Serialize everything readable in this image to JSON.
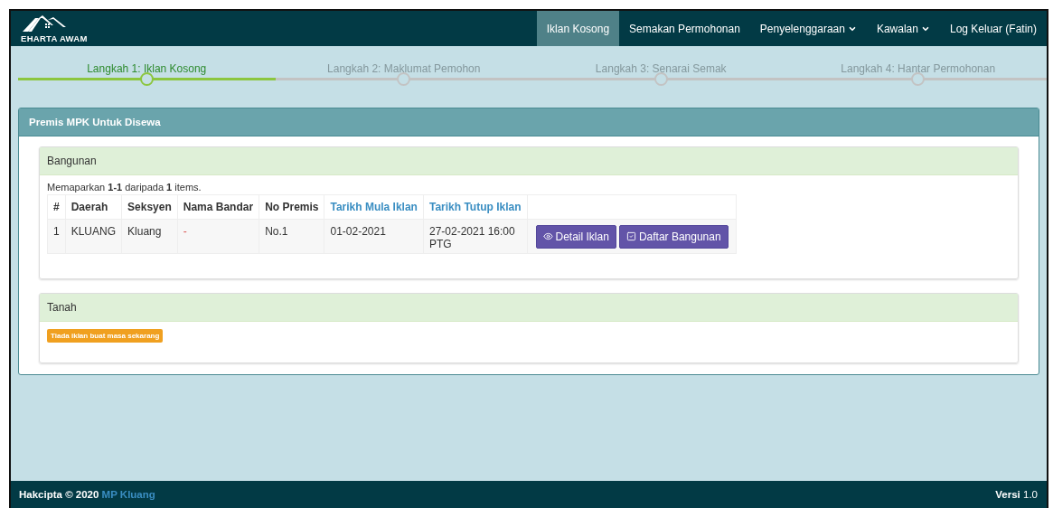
{
  "navbar": {
    "brand": "EHARTA AWAM",
    "items": [
      {
        "label": "Iklan Kosong",
        "selected": true,
        "dropdown": false
      },
      {
        "label": "Semakan Permohonan",
        "selected": false,
        "dropdown": false
      },
      {
        "label": "Penyelenggaraan",
        "selected": false,
        "dropdown": true
      },
      {
        "label": "Kawalan",
        "selected": false,
        "dropdown": true
      },
      {
        "label": "Log Keluar (Fatin)",
        "selected": false,
        "dropdown": false
      }
    ]
  },
  "steps": [
    {
      "label": "Langkah 1: Iklan Kosong",
      "active": true
    },
    {
      "label": "Langkah 2: Maklumat Pemohon",
      "active": false
    },
    {
      "label": "Langkah 3: Senarai Semak",
      "active": false
    },
    {
      "label": "Langkah 4: Hantar Permohonan",
      "active": false
    }
  ],
  "panel": {
    "title": "Premis MPK Untuk Disewa",
    "sections": [
      {
        "kind": "table",
        "title": "Bangunan",
        "summary": "Memaparkan **1-1** daripada **1** items.",
        "columns": [
          {
            "label": "#",
            "sortable": false
          },
          {
            "label": "Daerah",
            "sortable": false
          },
          {
            "label": "Seksyen",
            "sortable": false
          },
          {
            "label": "Nama Bandar",
            "sortable": false
          },
          {
            "label": "No Premis",
            "sortable": false
          },
          {
            "label": "Tarikh Mula Iklan",
            "sortable": true
          },
          {
            "label": "Tarikh Tutup Iklan",
            "sortable": true
          }
        ],
        "rows": [
          {
            "cells": [
              "1",
              "KLUANG",
              "Kluang",
              "-",
              "No.1",
              "01-02-2021",
              "27-02-2021 16:00 PTG"
            ],
            "actions": [
              {
                "label": "Detail Iklan",
                "kind": "view"
              },
              {
                "label": "Daftar Bangunan",
                "kind": "register"
              }
            ]
          }
        ]
      },
      {
        "kind": "notice",
        "title": "Tanah",
        "message": "Tiada iklan buat masa sekarang"
      }
    ]
  },
  "footer": {
    "copyright": "Hakcipta © 2020",
    "link": "MP Kluang",
    "version": "**Versi** 1.0"
  }
}
